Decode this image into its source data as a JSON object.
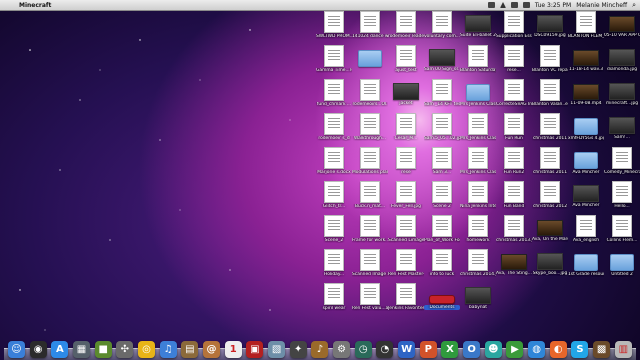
{
  "menubar": {
    "app_name": "Minecraft",
    "clock": "Tue 3:25 PM",
    "user": "Melanie Mincheff"
  },
  "desktop_icons": [
    {
      "label": "SWLTWD PROM...(5)",
      "kind": "doc"
    },
    {
      "label": "141024 dance week...",
      "kind": "doc"
    },
    {
      "label": "rodemoeir leadership...",
      "kind": "doc"
    },
    {
      "label": "voluntary com...",
      "kind": "doc"
    },
    {
      "label": "Suite Eli-ballet 2...",
      "kind": "photo"
    },
    {
      "label": "Supplication Essay 05...",
      "kind": "doc"
    },
    {
      "label": "DSC09159.jpg",
      "kind": "photo"
    },
    {
      "label": "BLANTON FLEM_ WENT",
      "kind": "doc"
    },
    {
      "label": "05-10 VAR APP C...2.pdf",
      "kind": "video"
    },
    {
      "label": "Gamma Time...review",
      "kind": "doc"
    },
    {
      "label": "",
      "kind": "folder"
    },
    {
      "label": "ajust_test",
      "kind": "doc"
    },
    {
      "label": "Sam 00 Sign_ss ..x",
      "kind": "photo"
    },
    {
      "label": "Blanton Saturday 01",
      "kind": "doc"
    },
    {
      "label": "rese...",
      "kind": "doc"
    },
    {
      "label": "Blanton VC repar...1.6.13",
      "kind": "doc"
    },
    {
      "label": "11-18-14 wav.3",
      "kind": "video"
    },
    {
      "label": "diamonda.jpg",
      "kind": "photo"
    },
    {
      "label": "fund_chmark ...",
      "kind": "doc"
    },
    {
      "label": "rodemeoirs...Ol.",
      "kind": "doc"
    },
    {
      "label": "jacket",
      "kind": "photo"
    },
    {
      "label": "Sam _14 KFT test4",
      "kind": "doc"
    },
    {
      "label": "Mrs Jenkins Class",
      "kind": "folder"
    },
    {
      "label": "CorrecteSVAG Intern...0420",
      "kind": "doc"
    },
    {
      "label": "Blanton Valan..email",
      "kind": "doc"
    },
    {
      "label": "11-09-08.mp4",
      "kind": "video"
    },
    {
      "label": "minecraft...jpg",
      "kind": "photo"
    },
    {
      "label": "rodemoeir s_d",
      "kind": "doc"
    },
    {
      "label": "Walkthrough...",
      "kind": "doc"
    },
    {
      "label": "Cesar_M...",
      "kind": "doc"
    },
    {
      "label": "Sam.5_05...02.jpg",
      "kind": "doc"
    },
    {
      "label": "Mrs_Jenkins Class",
      "kind": "doc"
    },
    {
      "label": "Fun Run",
      "kind": "doc"
    },
    {
      "label": "christmas 2011",
      "kind": "doc"
    },
    {
      "label": "xmfFDY5Gs 4.jpg",
      "kind": "folder"
    },
    {
      "label": "Sam!...",
      "kind": "photo"
    },
    {
      "label": "Marjorie s.docx",
      "kind": "doc"
    },
    {
      "label": "Modulations plan_work...",
      "kind": "doc"
    },
    {
      "label": "rese",
      "kind": "doc"
    },
    {
      "label": "Sam 3...",
      "kind": "doc"
    },
    {
      "label": "Mrs_Jenkins Class...",
      "kind": "doc"
    },
    {
      "label": "Fun Run2",
      "kind": "doc"
    },
    {
      "label": "christmas 2011",
      "kind": "doc"
    },
    {
      "label": "Ava Mincher",
      "kind": "folder"
    },
    {
      "label": "Comedy_Minecraft",
      "kind": "doc"
    },
    {
      "label": "Glitch_tr...",
      "kind": "doc"
    },
    {
      "label": "Buck.n_mat...",
      "kind": "doc"
    },
    {
      "label": "Fever_Fell.jpg",
      "kind": "doc"
    },
    {
      "label": "Scene 2",
      "kind": "doc"
    },
    {
      "label": "Nina Jenkins Interview",
      "kind": "doc"
    },
    {
      "label": "Fun Band",
      "kind": "doc"
    },
    {
      "label": "christmas 2012",
      "kind": "doc"
    },
    {
      "label": "Ava Mincher",
      "kind": "photo"
    },
    {
      "label": "Hello...",
      "kind": "doc"
    },
    {
      "label": "Scene_2",
      "kind": "doc"
    },
    {
      "label": "Frame for work...",
      "kind": "doc"
    },
    {
      "label": "Scanned Limage.jpeg",
      "kind": "doc"
    },
    {
      "label": "Plan_of_Work Form-2",
      "kind": "doc"
    },
    {
      "label": "homework",
      "kind": "doc"
    },
    {
      "label": "christmas 2013.jpg",
      "kind": "doc"
    },
    {
      "label": "Ava, On the March...2.MP4",
      "kind": "video"
    },
    {
      "label": "Ava_english",
      "kind": "doc"
    },
    {
      "label": "Collins Flem...",
      "kind": "doc"
    },
    {
      "label": "Holiday...",
      "kind": "doc"
    },
    {
      "label": "Scanned Image 2",
      "kind": "doc"
    },
    {
      "label": "Ren Fest Master-1",
      "kind": "doc"
    },
    {
      "label": "info to luck",
      "kind": "doc"
    },
    {
      "label": "christmas 2014.jpg",
      "kind": "doc"
    },
    {
      "label": "Ava, The Sting...2.MP4",
      "kind": "video"
    },
    {
      "label": "Skype_boo...jpg",
      "kind": "photo"
    },
    {
      "label": "1st Grade resources",
      "kind": "folder"
    },
    {
      "label": "Untitled 2",
      "kind": "folder"
    },
    {
      "label": "spiril wear",
      "kind": "doc"
    },
    {
      "label": "Ren Fest valu...al Sit",
      "kind": "doc"
    },
    {
      "label": "Jenkins Favorites",
      "kind": "doc"
    },
    {
      "label": "Documents",
      "kind": "selected"
    },
    {
      "label": "babynat",
      "kind": "photo"
    }
  ],
  "dock_icons": [
    {
      "name": "finder-icon",
      "color": "#3a7fd8",
      "glyph": "☺"
    },
    {
      "name": "dashboard-icon",
      "color": "#2b2b2b",
      "glyph": "◉"
    },
    {
      "name": "app-store-icon",
      "color": "#2d8ae8",
      "glyph": "A"
    },
    {
      "name": "mission-control-icon",
      "color": "#55606a",
      "glyph": "▦"
    },
    {
      "name": "minecraft-icon",
      "color": "#5b8a2e",
      "glyph": "■"
    },
    {
      "name": "compass-icon",
      "color": "#6a6a6a",
      "glyph": "✣"
    },
    {
      "name": "chrome-icon",
      "color": "#e8b417",
      "glyph": "◎"
    },
    {
      "name": "itunes-icon",
      "color": "#3d7fd8",
      "glyph": "♫"
    },
    {
      "name": "preview-icon",
      "color": "#8b6a3a",
      "glyph": "▤"
    },
    {
      "name": "address-book-icon",
      "color": "#b5733a",
      "glyph": "@"
    },
    {
      "name": "calendar-icon",
      "color": "#eeeeee",
      "glyph": "1"
    },
    {
      "name": "photo-booth-icon",
      "color": "#b32020",
      "glyph": "▣"
    },
    {
      "name": "iphoto-icon",
      "color": "#6d8ea8",
      "glyph": "▧"
    },
    {
      "name": "game-icon",
      "color": "#444444",
      "glyph": "✦"
    },
    {
      "name": "guitar-icon",
      "color": "#9a6a2a",
      "glyph": "♪"
    },
    {
      "name": "system-preferences-icon",
      "color": "#777777",
      "glyph": "⚙"
    },
    {
      "name": "time-machine-icon",
      "color": "#2a6a5a",
      "glyph": "◷"
    },
    {
      "name": "stopwatch-icon",
      "color": "#333333",
      "glyph": "◔"
    },
    {
      "name": "word-icon",
      "color": "#2e64c4",
      "glyph": "W"
    },
    {
      "name": "powerpoint-icon",
      "color": "#d2522a",
      "glyph": "P"
    },
    {
      "name": "excel-icon",
      "color": "#2f9a3d",
      "glyph": "X"
    },
    {
      "name": "outlook-icon",
      "color": "#3a78c8",
      "glyph": "O"
    },
    {
      "name": "messenger-icon",
      "color": "#2aa6a0",
      "glyph": "☻"
    },
    {
      "name": "facetime-icon",
      "color": "#3a9a3a",
      "glyph": "▶"
    },
    {
      "name": "safari-icon",
      "color": "#2f86d8",
      "glyph": "◍"
    },
    {
      "name": "firefox-icon",
      "color": "#e8662a",
      "glyph": "◐"
    },
    {
      "name": "skype-icon",
      "color": "#22a6e8",
      "glyph": "S"
    },
    {
      "name": "minecraft-block-icon",
      "color": "#6a4a2a",
      "glyph": "▩"
    },
    {
      "name": "trash-icon",
      "color": "#b8b8b8",
      "glyph": "▥"
    }
  ]
}
